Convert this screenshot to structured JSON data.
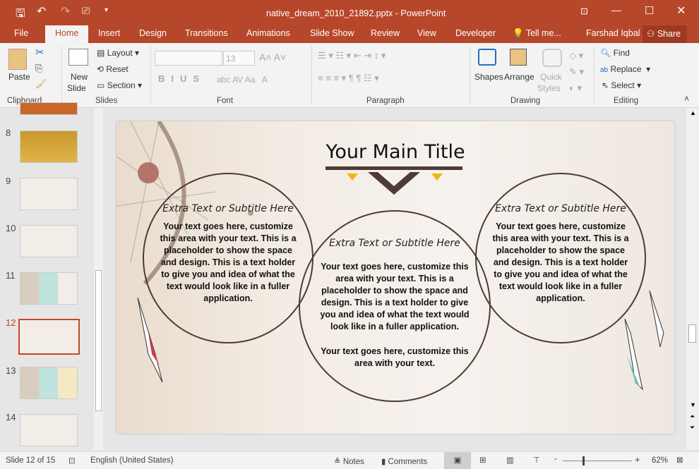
{
  "window": {
    "title": "native_dream_2010_21892.pptx - PowerPoint",
    "user": "Farshad Iqbal",
    "share": "Share"
  },
  "tabs": [
    {
      "label": "File"
    },
    {
      "label": "Home"
    },
    {
      "label": "Insert"
    },
    {
      "label": "Design"
    },
    {
      "label": "Transitions"
    },
    {
      "label": "Animations"
    },
    {
      "label": "Slide Show"
    },
    {
      "label": "Review"
    },
    {
      "label": "View"
    },
    {
      "label": "Developer"
    },
    {
      "label": "Tell me..."
    }
  ],
  "ribbon": {
    "paste": "Paste",
    "new_slide": "New",
    "new_slide2": "Slide",
    "layout": "Layout",
    "reset": "Reset",
    "section": "Section",
    "font_size": "13",
    "shapes": "Shapes",
    "arrange": "Arrange",
    "quick": "Quick",
    "styles": "Styles",
    "find": "Find",
    "replace": "Replace",
    "select": "Select",
    "groups": {
      "clipboard": "Clipboard",
      "slides": "Slides",
      "font": "Font",
      "paragraph": "Paragraph",
      "drawing": "Drawing",
      "editing": "Editing"
    }
  },
  "thumbnails": [
    {
      "num": "8"
    },
    {
      "num": "9"
    },
    {
      "num": "10"
    },
    {
      "num": "11"
    },
    {
      "num": "12",
      "selected": true
    },
    {
      "num": "13"
    },
    {
      "num": "14"
    }
  ],
  "slide": {
    "title": "Your Main Title",
    "circles": [
      {
        "subtitle": "Extra Text or Subtitle Here",
        "body": "Your text goes here, customize this area with your text. This is a placeholder to show the space and design. This is a text holder to give you and idea of what the text would look like in a fuller application."
      },
      {
        "subtitle": "Extra Text or Subtitle Here",
        "body": "Your text goes here, customize this area with your text. This is a placeholder to show the space and design. This is a text holder to give you and idea of what the text would look like in a fuller application.",
        "body2": "Your text goes here, customize this area with your text."
      },
      {
        "subtitle": "Extra Text or Subtitle Here",
        "body": "Your text goes here, customize this area with your text. This is a placeholder to show the space and design. This is a text holder to give you and idea of what the text would look like in a fuller application."
      }
    ]
  },
  "status": {
    "slide": "Slide 12 of 15",
    "language": "English (United States)",
    "notes": "Notes",
    "comments": "Comments",
    "zoom": "62%",
    "zoom_level_percent": 62
  },
  "colors": {
    "accent": "#b7472a",
    "circle": "#4e3b34",
    "ornament_yellow": "#f2b705"
  }
}
